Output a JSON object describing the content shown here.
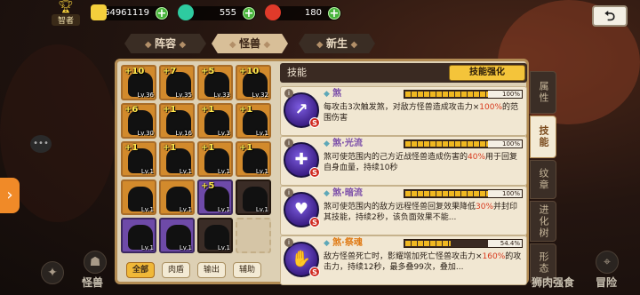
{
  "topbar": {
    "rank_label": "智者",
    "gold": "64961119",
    "gem": "555",
    "soul": "180",
    "colors": {
      "gold": "#f4cf3c",
      "gem": "#2ecba0",
      "soul": "#e03a2a",
      "plus": "#48b43c"
    }
  },
  "tabs": [
    {
      "label": "阵容",
      "active": false
    },
    {
      "label": "怪兽",
      "active": true
    },
    {
      "label": "新生",
      "active": false
    }
  ],
  "monsters": [
    {
      "plus": "+10",
      "lv": "Lv.36",
      "frame": "orange"
    },
    {
      "plus": "+7",
      "lv": "Lv.35",
      "frame": "orange"
    },
    {
      "plus": "+5",
      "lv": "Lv.33",
      "frame": "orange"
    },
    {
      "plus": "+10",
      "lv": "Lv.32",
      "frame": "orange"
    },
    {
      "plus": "+6",
      "lv": "Lv.30",
      "frame": "orange"
    },
    {
      "plus": "+1",
      "lv": "Lv.16",
      "frame": "orange"
    },
    {
      "plus": "+1",
      "lv": "Lv.3",
      "frame": "orange"
    },
    {
      "plus": "+1",
      "lv": "Lv.1",
      "frame": "orange"
    },
    {
      "plus": "+1",
      "lv": "Lv.1",
      "frame": "orange"
    },
    {
      "plus": "+1",
      "lv": "Lv.1",
      "frame": "orange"
    },
    {
      "plus": "+1",
      "lv": "Lv.1",
      "frame": "orange"
    },
    {
      "plus": "+1",
      "lv": "Lv.1",
      "frame": "orange"
    },
    {
      "plus": "",
      "lv": "Lv.1",
      "frame": "orange"
    },
    {
      "plus": "",
      "lv": "Lv.1",
      "frame": "orange"
    },
    {
      "plus": "+5",
      "lv": "Lv.1",
      "frame": "purple"
    },
    {
      "plus": "",
      "lv": "Lv.1",
      "frame": "dark"
    },
    {
      "plus": "",
      "lv": "Lv.1",
      "frame": "purple"
    },
    {
      "plus": "",
      "lv": "Lv.1",
      "frame": "purple"
    },
    {
      "plus": "",
      "lv": "Lv.1",
      "frame": "dark"
    },
    {
      "plus": "",
      "lv": "",
      "frame": "empty"
    }
  ],
  "filters": [
    "全部",
    "肉盾",
    "输出",
    "辅助"
  ],
  "skills": {
    "header": "技能",
    "enhance_label": "技能强化",
    "items": [
      {
        "icon": "spear-icon",
        "glyph": "↗",
        "name": "煞",
        "percent": "100%",
        "desc_a": "每攻击3次触发煞，对敌方怪兽造成攻击力×",
        "desc_hl": "100%",
        "desc_b": "的范围伤害",
        "name_color": "purple"
      },
      {
        "icon": "cross-icon",
        "glyph": "✚",
        "name": "煞·光流",
        "percent": "100%",
        "desc_a": "煞可使范围内的己方近战怪兽造成伤害的",
        "desc_hl": "40%",
        "desc_b": "用于回复自身血量，持续10秒",
        "name_color": "purple"
      },
      {
        "icon": "dark-orb-icon",
        "glyph": "♥",
        "name": "煞·暗流",
        "percent": "100%",
        "desc_a": "煞可使范围内的敌方远程怪兽回复效果降低",
        "desc_hl": "30%",
        "desc_b": "并封印其技能，持续2秒，该负面效果不能...",
        "name_color": "purple"
      },
      {
        "icon": "hands-icon",
        "glyph": "✋",
        "name": "煞·祭魂",
        "percent": "54.4%",
        "desc_a": "敌方怪兽死亡时，影耀增加死亡怪兽攻击力×",
        "desc_hl": "160%",
        "desc_b": "的攻击力，持续12秒，最多叠99次，叠加...",
        "name_color": "orange"
      }
    ]
  },
  "side_tabs": [
    {
      "label": "属性",
      "active": false
    },
    {
      "label": "技能",
      "active": true
    },
    {
      "label": "纹章",
      "active": false
    },
    {
      "label": "进化树",
      "active": false
    },
    {
      "label": "形态",
      "active": false
    }
  ],
  "bottom": {
    "monster_label": "怪兽",
    "feast_label": "狮肉强食",
    "adventure_label": "冒险"
  }
}
